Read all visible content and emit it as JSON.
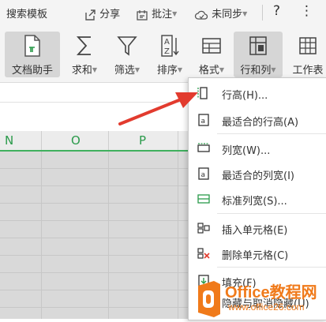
{
  "top_bar": {
    "template_search": "搜索模板",
    "share": "分享",
    "comment": "批注",
    "sync_status": "未同步",
    "help": "?",
    "more": "⋮"
  },
  "ribbon": {
    "doc_helper": "文档助手",
    "sum": "求和",
    "filter": "筛选",
    "sort": "排序",
    "format": "格式",
    "rows_cols": "行和列",
    "worksheet": "工作表"
  },
  "columns": [
    "N",
    "O",
    "P"
  ],
  "menu": {
    "items": [
      {
        "label": "行高(H)...",
        "icon": "row-height-icon"
      },
      {
        "label": "最适合的行高(A)",
        "icon": "auto-row-height-icon"
      },
      {
        "label": "列宽(W)...",
        "icon": "column-width-icon"
      },
      {
        "label": "最适合的列宽(I)",
        "icon": "auto-column-width-icon"
      },
      {
        "label": "标准列宽(S)...",
        "icon": "standard-width-icon"
      },
      {
        "label": "插入单元格(E)",
        "icon": "insert-cells-icon"
      },
      {
        "label": "删除单元格(C)",
        "icon": "delete-cells-icon"
      },
      {
        "label": "填充(F)",
        "icon": "fill-icon"
      },
      {
        "label": "隐藏与取消隐藏(U)",
        "icon": "hide-unhide-icon"
      }
    ]
  },
  "watermark": {
    "brand": "Office教程网",
    "url": "www.office26.com"
  },
  "colors": {
    "accent_green": "#2a9a4a",
    "arrow_red": "#e23b2e",
    "watermark_orange": "#f07a1a"
  }
}
